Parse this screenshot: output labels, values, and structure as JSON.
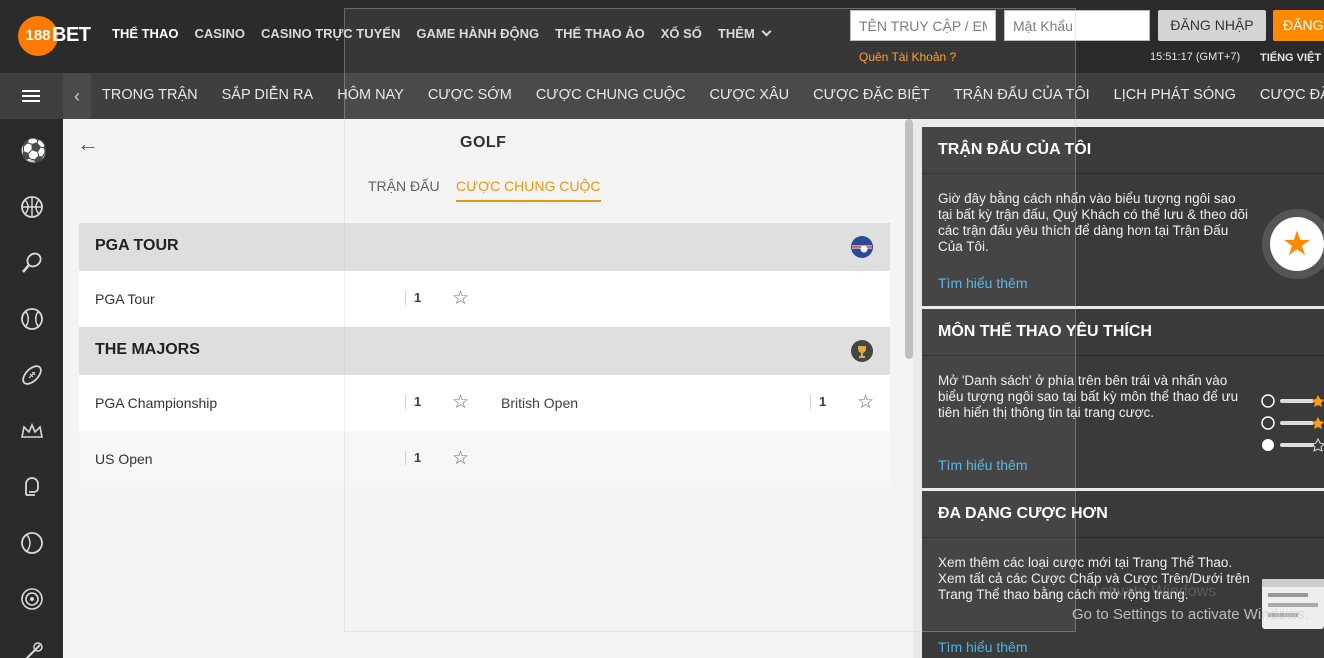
{
  "header": {
    "logo_mark": "188",
    "logo_text": "BET",
    "nav": [
      "THỂ THAO",
      "CASINO",
      "CASINO TRỰC TUYẾN",
      "GAME HÀNH ĐỘNG",
      "THỂ THAO ẢO",
      "XỔ SỐ",
      "THÊM"
    ],
    "username_placeholder": "TÊN TRUY CẬP / EMAIL",
    "password_placeholder": "Mật Khẩu",
    "login_label": "ĐĂNG NHẬP",
    "register_label": "ĐĂNG",
    "forgot_label": "Quên Tài Khoản ?",
    "clock": "15:51:17 (GMT+7)",
    "language": "TIẾNG VIỆT"
  },
  "subnav": {
    "items": [
      "TRONG TRẬN",
      "SẮP DIỄN RA",
      "HÔM NAY",
      "CƯỢC SỚM",
      "CƯỢC CHUNG CUỘC",
      "CƯỢC XÂU",
      "CƯỢC ĐẶC BIỆT",
      "TRẬN ĐẤU CỦA TÔI",
      "LỊCH PHÁT SÓNG",
      "CƯỢC ĐÃ ĐẶT"
    ]
  },
  "sidebar": {
    "sports": [
      "soccer-icon",
      "basketball-icon",
      "tennis-icon",
      "baseball-icon",
      "american-football-icon",
      "crown-icon",
      "boxing-icon",
      "cricket-icon",
      "target-icon",
      "golf-icon"
    ]
  },
  "main": {
    "title": "GOLF",
    "tabs": [
      "TRẬN ĐẤU",
      "CƯỢC CHUNG CUỘC"
    ],
    "active_tab": "CƯỢC CHUNG CUỘC",
    "sections": [
      {
        "title": "PGA TOUR",
        "rows": [
          {
            "name": "PGA Tour",
            "odds": "1"
          }
        ]
      },
      {
        "title": "THE MAJORS",
        "rows": [
          {
            "name": "PGA Championship",
            "odds": "1",
            "name2": "British Open",
            "odds2": "1"
          },
          {
            "name": "US Open",
            "odds": "1"
          }
        ]
      }
    ]
  },
  "right_panel": {
    "cards": [
      {
        "title": "TRẬN ĐẤU CỦA TÔI",
        "text": "Giờ đây bằng cách nhấn vào biểu tượng ngôi sao tại bất kỳ trận đấu, Quý Khách có thể lưu & theo dõi các trận đấu yêu thích để dàng hơn tại Trận Đấu Của Tôi.",
        "link": "Tìm hiểu thêm"
      },
      {
        "title": "MÔN THỂ THAO YÊU THÍCH",
        "text": "Mở 'Danh sách' ở phía trên bên trái và nhấn vào biểu tượng ngôi sao tại bất kỳ môn thể thao để ưu tiên hiển thị thông tin tại trang cược.",
        "link": "Tìm hiểu thêm"
      },
      {
        "title": "ĐA DẠNG CƯỢC HƠN",
        "text": "Xem thêm các loại cược mới tại Trang Thể Thao. Xem tất cả các Cược Chấp và Cược Trên/Dưới trên Trang Thể thao bằng cách mở rộng trang.",
        "link": "Tìm hiểu thêm"
      }
    ]
  },
  "overlay": {
    "activate_title": "Activate Windows",
    "activate_sub": "Go to Settings to activate Windows."
  },
  "colors": {
    "accent": "#ff8a00",
    "link": "#4fb3e8",
    "header_bg": "#2b2b2b"
  }
}
